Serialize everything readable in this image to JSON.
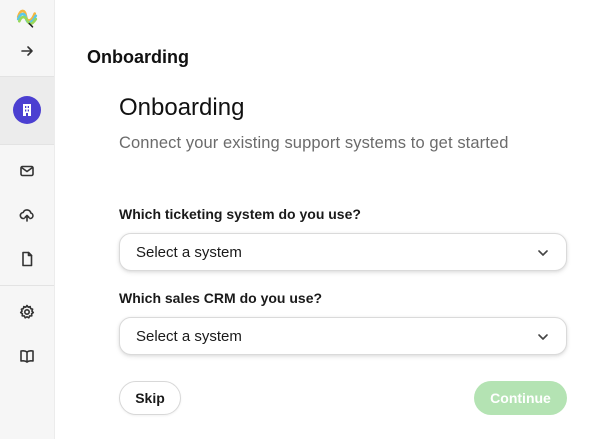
{
  "sidebar": {
    "logo_icon": "rainbow-swirl-logo",
    "items": [
      {
        "name": "expand-sidebar",
        "icon": "arrow-right-icon"
      },
      {
        "name": "organization",
        "icon": "building-icon",
        "active": true
      },
      {
        "name": "inbox",
        "icon": "mail-icon"
      },
      {
        "name": "sync",
        "icon": "cloud-upload-icon"
      },
      {
        "name": "documents",
        "icon": "file-icon"
      },
      {
        "name": "settings",
        "icon": "gear-icon"
      },
      {
        "name": "docs",
        "icon": "book-icon"
      }
    ],
    "avatar_color": "#4b3fd1"
  },
  "page": {
    "title": "Onboarding"
  },
  "onboarding": {
    "heading": "Onboarding",
    "subtitle": "Connect your existing support systems to get started",
    "ticketing": {
      "label": "Which ticketing system do you use?",
      "value": "Select a system"
    },
    "crm": {
      "label": "Which sales CRM do you use?",
      "value": "Select a system"
    },
    "skip_label": "Skip",
    "continue_label": "Continue",
    "continue_disabled": true,
    "continue_color": "#b4e3b3"
  }
}
